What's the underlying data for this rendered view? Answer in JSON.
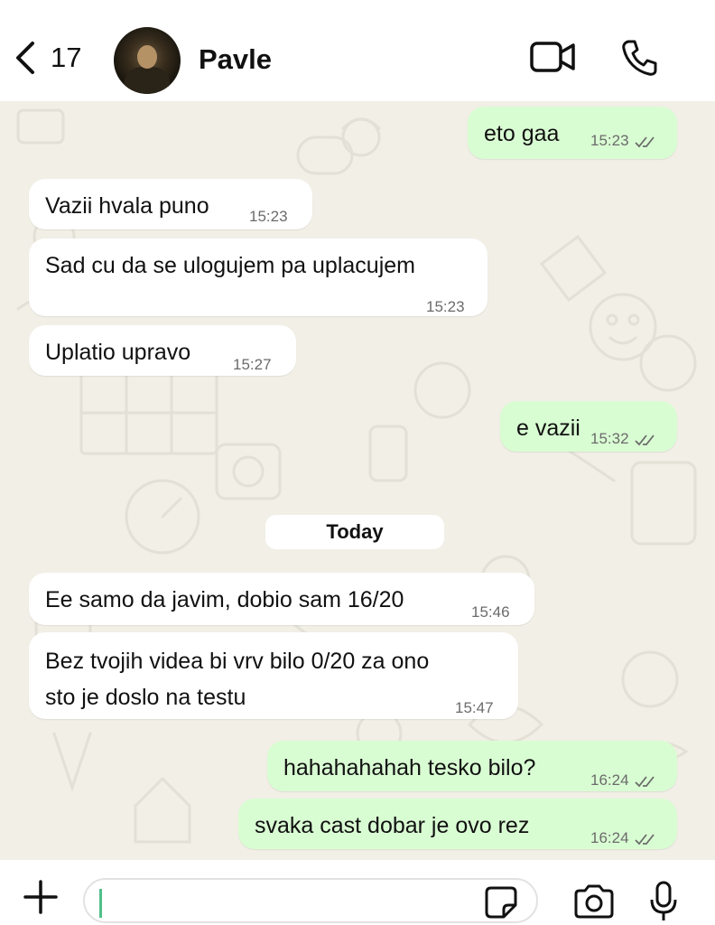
{
  "header": {
    "back_count": "17",
    "contact_name": "Pavle"
  },
  "chat": {
    "messages": [
      {
        "dir": "out",
        "text": "eto gaa",
        "time": "15:23",
        "status": "read"
      },
      {
        "dir": "in",
        "text": "Vazii hvala puno",
        "time": "15:23"
      },
      {
        "dir": "in",
        "text": "Sad cu da se ulogujem pa uplacujem",
        "time": "15:23"
      },
      {
        "dir": "in",
        "text": "Uplatio upravo",
        "time": "15:27"
      },
      {
        "dir": "out",
        "text": "e vazii",
        "time": "15:32",
        "status": "read"
      },
      {
        "dir": "in",
        "text": "Ee samo da javim, dobio sam 16/20",
        "time": "15:46"
      },
      {
        "dir": "in",
        "text_line1": "Bez tvojih videa bi vrv bilo 0/20 za ono",
        "text_line2": "sto je doslo na testu",
        "time": "15:47"
      },
      {
        "dir": "out",
        "text": "hahahahahah tesko bilo?",
        "time": "16:24",
        "status": "read"
      },
      {
        "dir": "out",
        "text": "svaka cast dobar je ovo rez",
        "time": "16:24",
        "status": "read"
      }
    ],
    "date_separator": "Today"
  },
  "footer": {
    "input_value": "",
    "input_placeholder": ""
  },
  "icons": {
    "back": "chevron-left-icon",
    "video": "video-camera-icon",
    "phone": "phone-icon",
    "plus": "plus-icon",
    "sticker": "sticker-icon",
    "camera": "camera-icon",
    "mic": "microphone-icon",
    "ticks": "double-check-icon"
  },
  "colors": {
    "outgoing_bubble": "#d9fdd3",
    "incoming_bubble": "#ffffff",
    "read_ticks": "#6b6b6b",
    "wallpaper": "#f1efe6"
  }
}
